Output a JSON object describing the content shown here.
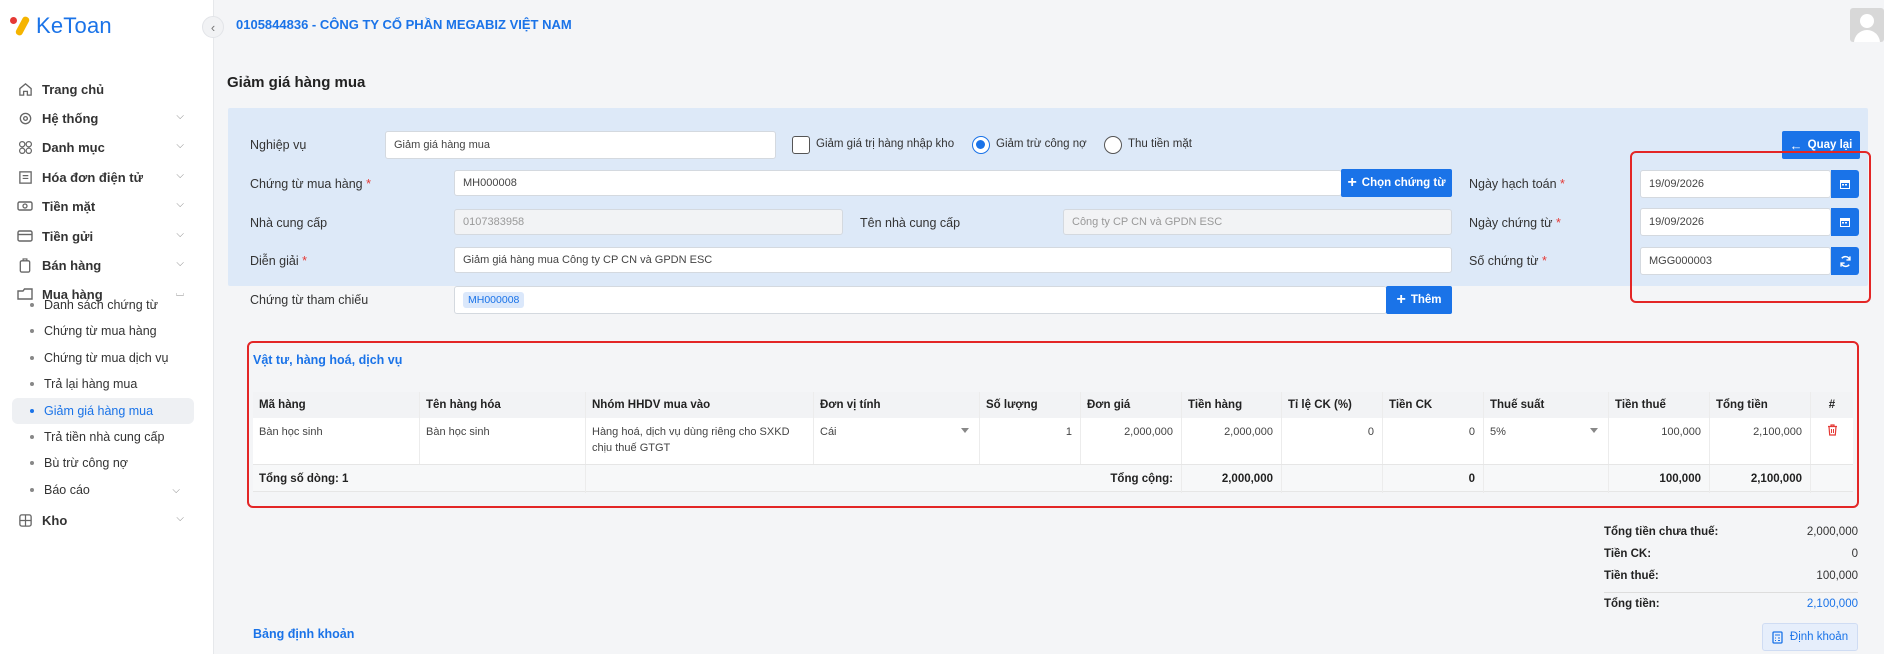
{
  "app": {
    "logo_text": "KeToan"
  },
  "header": {
    "company": "0105844836 - CÔNG TY CỔ PHẦN MEGABIZ VIỆT NAM"
  },
  "sidebar": {
    "items": [
      {
        "label": "Trang chủ",
        "icon": "home-icon"
      },
      {
        "label": "Hệ thống",
        "icon": "gear-icon"
      },
      {
        "label": "Danh mục",
        "icon": "grid-icon"
      },
      {
        "label": "Hóa đơn điện tử",
        "icon": "invoice-icon"
      },
      {
        "label": "Tiền mặt",
        "icon": "cash-icon"
      },
      {
        "label": "Tiền gửi",
        "icon": "card-icon"
      },
      {
        "label": "Bán hàng",
        "icon": "sales-icon"
      },
      {
        "label": "Mua hàng",
        "icon": "purchase-icon"
      },
      {
        "label": "Kho",
        "icon": "warehouse-icon"
      }
    ],
    "sub_items": [
      {
        "label": "Danh sách chứng từ"
      },
      {
        "label": "Chứng từ mua hàng"
      },
      {
        "label": "Chứng từ mua dịch vụ"
      },
      {
        "label": "Trả lại hàng mua"
      },
      {
        "label": "Giảm giá hàng mua"
      },
      {
        "label": "Trả tiền nhà cung cấp"
      },
      {
        "label": "Bù trừ công nợ"
      },
      {
        "label": "Báo cáo"
      }
    ]
  },
  "page": {
    "title": "Giảm giá hàng mua"
  },
  "form": {
    "nghiep_vu_label": "Nghiệp vụ",
    "nghiep_vu_value": "Giảm giá hàng mua",
    "opt_checkbox": "Giảm giá trị hàng nhập kho",
    "opt_radio1": "Giảm trừ công nợ",
    "opt_radio2": "Thu tiền mặt",
    "back_button": "Quay lại",
    "chung_tu_mua_label": "Chứng từ mua hàng",
    "chung_tu_mua_value": "MH000008",
    "chon_chung_tu_button": "Chọn chứng từ",
    "nha_cung_cap_label": "Nhà cung cấp",
    "nha_cung_cap_value": "0107383958",
    "ten_ncc_label": "Tên nhà cung cấp",
    "ten_ncc_value": "Công ty CP CN và GPDN ESC",
    "dien_giai_label": "Diễn giải",
    "dien_giai_value": "Giảm giá hàng mua Công ty CP CN và GPDN ESC",
    "tham_chieu_label": "Chứng từ tham chiếu",
    "tham_chieu_tag": "MH000008",
    "them_button": "Thêm",
    "ngay_hach_toan_label": "Ngày hạch toán",
    "ngay_hach_toan_value": "19/09/2026",
    "ngay_chung_tu_label": "Ngày chứng từ",
    "ngay_chung_tu_value": "19/09/2026",
    "so_chung_tu_label": "Số chứng từ",
    "so_chung_tu_value": "MGG000003",
    "required_mark": "*"
  },
  "table": {
    "section_title": "Vật tư, hàng hoá, dịch vụ",
    "headers": [
      "Mã hàng",
      "Tên hàng hóa",
      "Nhóm HHDV mua vào",
      "Đơn vị tính",
      "Số lượng",
      "Đơn giá",
      "Tiền hàng",
      "Tỉ lệ CK (%)",
      "Tiền CK",
      "Thuế suất",
      "Tiền thuế",
      "Tổng tiền",
      "#"
    ],
    "row": {
      "ma_hang": "Bàn học sinh",
      "ten_hang": "Bàn học sinh",
      "nhom": "Hàng hoá, dịch vụ dùng riêng cho SXKD chịu thuế GTGT",
      "don_vi": "Cái",
      "so_luong": "1",
      "don_gia": "2,000,000",
      "tien_hang": "2,000,000",
      "ti_le_ck": "0",
      "tien_ck": "0",
      "thue_suat": "5%",
      "tien_thue": "100,000",
      "tong_tien": "2,100,000"
    },
    "footer": {
      "row_count": "Tổng số dòng: 1",
      "total_label": "Tổng cộng:",
      "tien_hang": "2,000,000",
      "tien_ck": "0",
      "tien_thue": "100,000",
      "tong_tien": "2,100,000"
    }
  },
  "summary": {
    "chua_thue_label": "Tổng tiền chưa thuế:",
    "chua_thue_value": "2,000,000",
    "ck_label": "Tiền CK:",
    "ck_value": "0",
    "thue_label": "Tiền thuế:",
    "thue_value": "100,000",
    "tong_label": "Tổng tiền:",
    "tong_value": "2,100,000"
  },
  "footer_links": {
    "bang_dinh_khoan": "Bảng định khoản",
    "dinh_khoan_button": "Định khoản"
  },
  "colors": {
    "accent": "#1a73e8",
    "panel": "#dde9f8",
    "highlight_border": "#e32626"
  }
}
